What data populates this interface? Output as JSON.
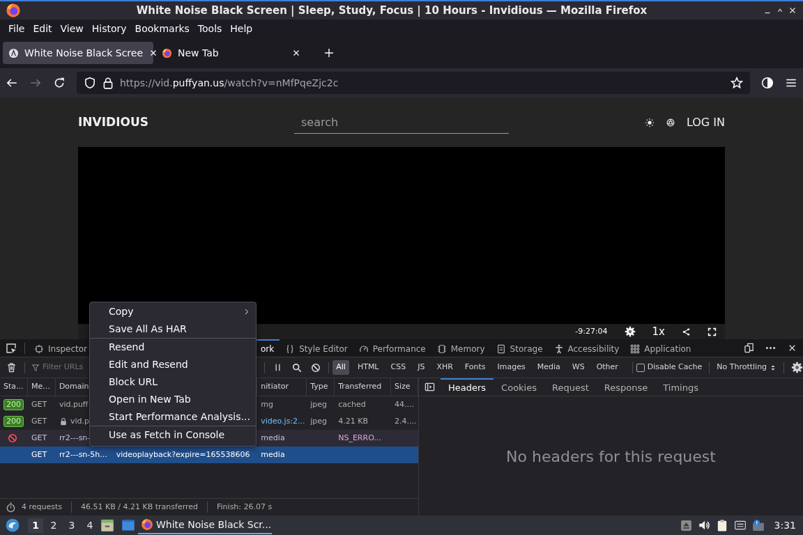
{
  "window": {
    "title": "White Noise Black Screen | Sleep, Study, Focus | 10 Hours - Invidious — Mozilla Firefox"
  },
  "menu_bar": [
    "File",
    "Edit",
    "View",
    "History",
    "Bookmarks",
    "Tools",
    "Help"
  ],
  "tabs": [
    {
      "label": "White Noise Black Scree",
      "selected": true
    },
    {
      "label": "New Tab",
      "selected": false
    }
  ],
  "nav": {
    "forward_disabled": true,
    "url": {
      "prefix": "https://vid.",
      "domain": "puffyan.us",
      "path": "/watch?v=nMfPqeZjc2c"
    }
  },
  "page": {
    "logo": "INVIDIOUS",
    "search": {
      "placeholder": "search"
    },
    "login": "LOG IN",
    "player": {
      "time": "-9:27:04",
      "speed": "1x"
    }
  },
  "devtools": {
    "tools": [
      {
        "label": "Inspector",
        "selected": false
      },
      {
        "label": "ork",
        "selected": true
      },
      {
        "label": "Style Editor",
        "selected": false
      },
      {
        "label": "Performance",
        "selected": false
      },
      {
        "label": "Memory",
        "selected": false
      },
      {
        "label": "Storage",
        "selected": false
      },
      {
        "label": "Accessibility",
        "selected": false
      },
      {
        "label": "Application",
        "selected": false
      }
    ],
    "filter": {
      "placeholder": "Filter URLs"
    },
    "type_filters": [
      {
        "label": "All",
        "selected": true
      },
      {
        "label": "HTML",
        "selected": false
      },
      {
        "label": "CSS",
        "selected": false
      },
      {
        "label": "JS",
        "selected": false
      },
      {
        "label": "XHR",
        "selected": false
      },
      {
        "label": "Fonts",
        "selected": false
      },
      {
        "label": "Images",
        "selected": false
      },
      {
        "label": "Media",
        "selected": false
      },
      {
        "label": "WS",
        "selected": false
      },
      {
        "label": "Other",
        "selected": false
      }
    ],
    "disable_cache": {
      "label": "Disable Cache",
      "checked": false
    },
    "throttling": "No Throttling",
    "columns": [
      "Sta...",
      "Me...",
      "Domain",
      "nitiator",
      "Type",
      "Transferred",
      "Size"
    ],
    "requests": [
      {
        "blocked": false,
        "status": "200",
        "method": "GET",
        "domain": "vid.puff",
        "secure": false,
        "initiator": "mg",
        "initiator_link": false,
        "type": "jpeg",
        "transferred": "cached",
        "size": "44....",
        "selected": false
      },
      {
        "blocked": false,
        "status": "200",
        "method": "GET",
        "domain": "vid.p",
        "secure": true,
        "initiator": "video.js:2...",
        "initiator_link": true,
        "type": "jpeg",
        "transferred": "4.21 KB",
        "size": "2.4....",
        "selected": false
      },
      {
        "blocked": true,
        "method": "GET",
        "domain": "rr2---sn-",
        "secure": false,
        "initiator": "media",
        "initiator_link": false,
        "transferred": "NS_ERRO...",
        "selected": false
      },
      {
        "blocked": false,
        "method": "GET",
        "domain": "rr2---sn-5h...",
        "secure": false,
        "file": "videoplayback?expire=165538606",
        "initiator": "media",
        "initiator_link": false,
        "selected": true
      }
    ],
    "detail_tabs": [
      {
        "label": "Headers",
        "selected": true
      },
      {
        "label": "Cookies",
        "selected": false
      },
      {
        "label": "Request",
        "selected": false
      },
      {
        "label": "Response",
        "selected": false
      },
      {
        "label": "Timings",
        "selected": false
      }
    ],
    "detail_message": "No headers for this request",
    "summary": [
      "4 requests",
      "46.51 KB / 4.21 KB transferred",
      "Finish: 26.07 s"
    ]
  },
  "context_menu": {
    "items": [
      {
        "kind": "item",
        "label": "Copy",
        "submenu": true
      },
      {
        "kind": "item",
        "label": "Save All As HAR",
        "submenu": false
      },
      {
        "kind": "separator"
      },
      {
        "kind": "item",
        "label": "Resend",
        "submenu": false
      },
      {
        "kind": "item",
        "label": "Edit and Resend",
        "submenu": false
      },
      {
        "kind": "item",
        "label": "Block URL",
        "submenu": false
      },
      {
        "kind": "item",
        "label": "Open in New Tab",
        "submenu": false
      },
      {
        "kind": "item",
        "label": "Start Performance Analysis...",
        "submenu": false
      },
      {
        "kind": "separator"
      },
      {
        "kind": "item",
        "label": "Use as Fetch in Console",
        "submenu": false
      }
    ]
  },
  "taskbar": {
    "workspaces": [
      {
        "label": "1",
        "selected": true
      },
      {
        "label": "2",
        "selected": false
      },
      {
        "label": "3",
        "selected": false
      },
      {
        "label": "4",
        "selected": false
      }
    ],
    "task": "White Noise Black Scr...",
    "clock": "3:31"
  }
}
